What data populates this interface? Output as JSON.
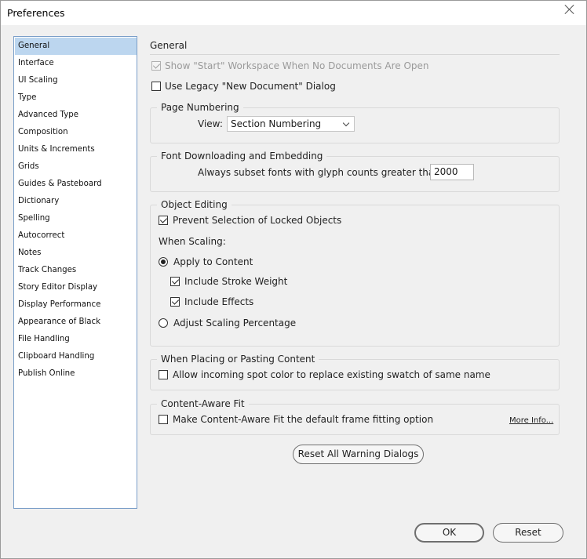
{
  "window": {
    "title": "Preferences"
  },
  "sidebar": {
    "items": [
      {
        "label": "General",
        "selected": true
      },
      {
        "label": "Interface"
      },
      {
        "label": "UI Scaling"
      },
      {
        "label": "Type"
      },
      {
        "label": "Advanced Type"
      },
      {
        "label": "Composition"
      },
      {
        "label": "Units & Increments"
      },
      {
        "label": "Grids"
      },
      {
        "label": "Guides & Pasteboard"
      },
      {
        "label": "Dictionary"
      },
      {
        "label": "Spelling"
      },
      {
        "label": "Autocorrect"
      },
      {
        "label": "Notes"
      },
      {
        "label": "Track Changes"
      },
      {
        "label": "Story Editor Display"
      },
      {
        "label": "Display Performance"
      },
      {
        "label": "Appearance of Black"
      },
      {
        "label": "File Handling"
      },
      {
        "label": "Clipboard Handling"
      },
      {
        "label": "Publish Online"
      }
    ]
  },
  "main": {
    "title": "General",
    "show_start_workspace": {
      "label": "Show \"Start\" Workspace When No Documents Are Open",
      "checked": true,
      "disabled": true
    },
    "use_legacy_new_doc": {
      "label": "Use Legacy \"New Document\" Dialog",
      "checked": false
    },
    "page_numbering": {
      "legend": "Page Numbering",
      "view_label": "View:",
      "view_value": "Section Numbering"
    },
    "font_downloading": {
      "legend": "Font Downloading and Embedding",
      "subset_label": "Always subset fonts with glyph counts greater than:",
      "subset_value": "2000"
    },
    "object_editing": {
      "legend": "Object Editing",
      "prevent_locked": {
        "label": "Prevent Selection of Locked Objects",
        "checked": true
      },
      "when_scaling_label": "When Scaling:",
      "apply_to_content": {
        "label": "Apply to Content",
        "selected": true
      },
      "include_stroke": {
        "label": "Include Stroke Weight",
        "checked": true
      },
      "include_effects": {
        "label": "Include Effects",
        "checked": true
      },
      "adjust_scaling": {
        "label": "Adjust Scaling Percentage",
        "selected": false
      }
    },
    "placing": {
      "legend": "When Placing or Pasting Content",
      "spot_color": {
        "label": "Allow incoming spot color to replace existing swatch of same name",
        "checked": false
      }
    },
    "content_aware": {
      "legend": "Content-Aware Fit",
      "make_default": {
        "label": "Make Content-Aware Fit the default frame fitting option",
        "checked": false
      },
      "more_info": "More Info..."
    },
    "reset_warnings_label": "Reset All Warning Dialogs"
  },
  "footer": {
    "ok_label": "OK",
    "reset_label": "Reset"
  }
}
